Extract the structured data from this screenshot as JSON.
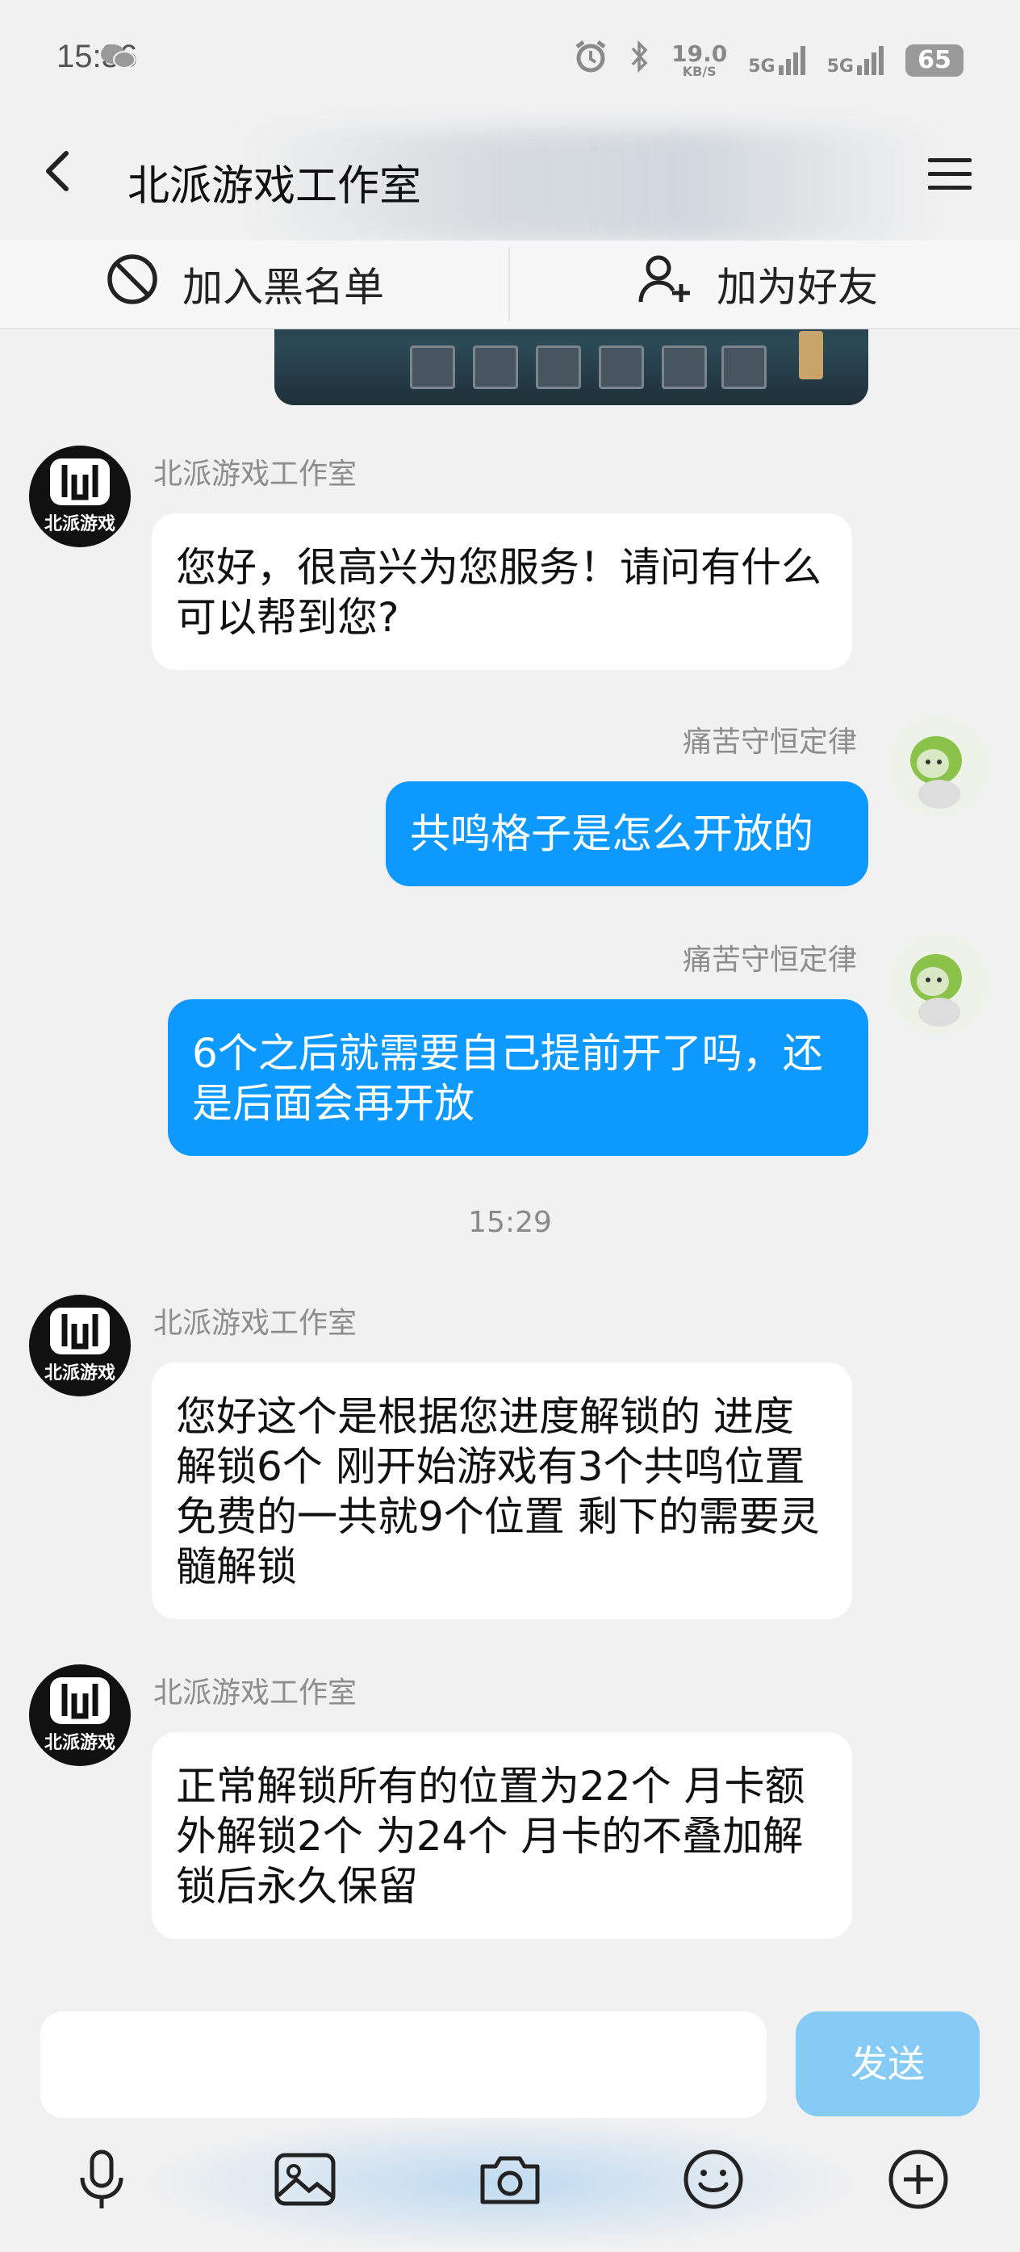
{
  "status_bar": {
    "time": "15:36",
    "net_speed_value": "19.0",
    "net_speed_unit": "KB/S",
    "signal_1": "5G",
    "signal_2": "5G",
    "battery": "65"
  },
  "header": {
    "title": "北派游戏工作室"
  },
  "actions": {
    "block_label": "加入黑名单",
    "add_friend_label": "加为好友"
  },
  "messages": [
    {
      "side": "left",
      "sender": "北派游戏工作室",
      "text": "您好，很高兴为您服务！请问有什么可以帮到您?"
    },
    {
      "side": "right",
      "sender": "痛苦守恒定律",
      "text": "共鸣格子是怎么开放的"
    },
    {
      "side": "right",
      "sender": "痛苦守恒定律",
      "text": "6个之后就需要自己提前开了吗，还是后面会再开放"
    },
    {
      "side": "center",
      "text": "15:29"
    },
    {
      "side": "left",
      "sender": "北派游戏工作室",
      "text": "您好这个是根据您进度解锁的 进度解锁6个 刚开始游戏有3个共鸣位置  免费的一共就9个位置 剩下的需要灵髓解锁"
    },
    {
      "side": "left",
      "sender": "北派游戏工作室",
      "text": "正常解锁所有的位置为22个 月卡额外解锁2个 为24个 月卡的不叠加解锁后永久保留"
    }
  ],
  "studio_logo_text": "北派游戏",
  "composer": {
    "input_value": "",
    "send_label": "发送"
  },
  "toolbar": {
    "icons": [
      "microphone-icon",
      "image-icon",
      "camera-icon",
      "emoji-icon",
      "plus-icon"
    ]
  },
  "colors": {
    "accent": "#0d99ff",
    "send_disabled": "#86caf6",
    "background": "#f1f1f1"
  }
}
